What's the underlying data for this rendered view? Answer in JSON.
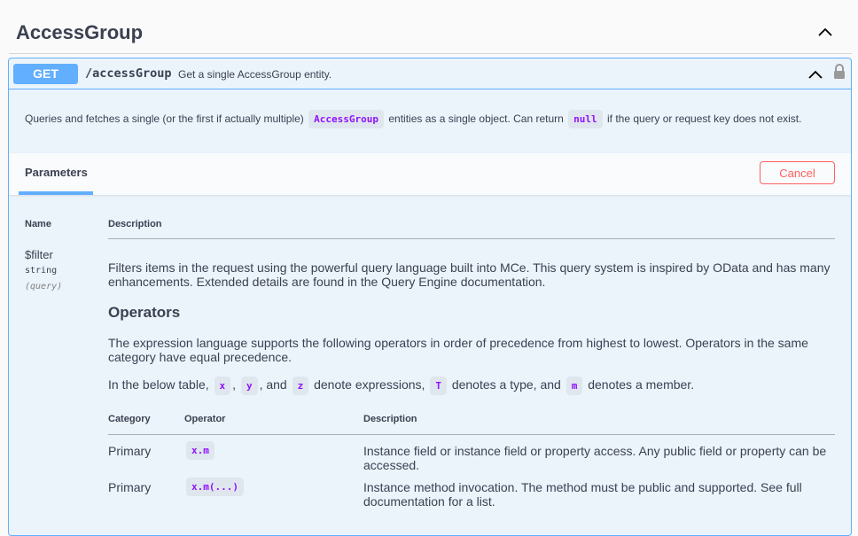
{
  "tag": {
    "title": "AccessGroup"
  },
  "operation": {
    "method": "GET",
    "path": "/accessGroup",
    "summary": "Get a single AccessGroup entity.",
    "description": {
      "part1": "Queries and fetches a single (or the first if actually multiple)",
      "code1": "AccessGroup",
      "part2": "entities as a single object. Can return",
      "code2": "null",
      "part3": "if the query or request key does not exist."
    }
  },
  "parameters_section": {
    "tab_label": "Parameters",
    "cancel_label": "Cancel"
  },
  "params_table": {
    "col_name": "Name",
    "col_description": "Description"
  },
  "param": {
    "name": "$filter",
    "type": "string",
    "in": "(query)",
    "intro": "Filters items in the request using the powerful query language built into MCe. This query system is inspired by OData and has many enhancements. Extended details are found in the Query Engine documentation.",
    "operators_heading": "Operators",
    "operators_intro": "The expression language supports the following operators in order of precedence from highest to lowest. Operators in the same category have equal precedence.",
    "legend": {
      "t1": "In the below table,",
      "x": "x",
      "c1": ",",
      "y": "y",
      "t2": ", and",
      "z": "z",
      "t3": "denote expressions,",
      "T": "T",
      "t4": "denotes a type, and",
      "m": "m",
      "t5": "denotes a member."
    }
  },
  "operators_table": {
    "col_category": "Category",
    "col_operator": "Operator",
    "col_description": "Description",
    "rows": [
      {
        "category": "Primary",
        "operator": "x.m",
        "description": "Instance field or instance field or property access. Any public field or property can be accessed."
      },
      {
        "category": "Primary",
        "operator": "x.m(...)",
        "description": "Instance method invocation. The method must be public and supported. See full documentation for a list."
      }
    ]
  },
  "colors": {
    "get_accent": "#61affe",
    "code_purple": "#9012fe",
    "cancel_red": "#ff6060"
  }
}
